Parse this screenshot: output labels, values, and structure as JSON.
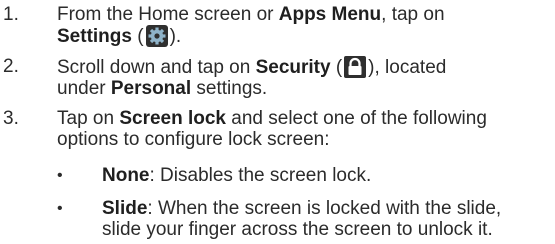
{
  "steps": [
    {
      "number": "1.",
      "line1_pre": "From the Home screen or ",
      "line1_bold": "Apps Menu",
      "line1_post": ", tap on",
      "line2_bold": "Settings",
      "line2_pre_icon": " (",
      "line2_icon": "settings-gear-icon",
      "line2_post": ")."
    },
    {
      "number": "2.",
      "line1_pre": "Scroll down and tap on ",
      "line1_bold": "Security",
      "line1_pre_icon": " (",
      "line1_icon": "lock-icon",
      "line1_post": "), located",
      "line2_pre": "under ",
      "line2_bold": "Personal",
      "line2_post": " settings."
    },
    {
      "number": "3.",
      "line1_pre": "Tap on ",
      "line1_bold": "Screen lock",
      "line1_post": " and select one of the following",
      "line2": "options to configure lock screen:"
    }
  ],
  "bullets": [
    {
      "marker": "•",
      "bold": "None",
      "text": ": Disables the screen lock."
    },
    {
      "marker": "•",
      "bold": "Slide",
      "text": ": When the screen is locked with the slide,",
      "line2": "slide your finger across the screen to unlock it."
    }
  ],
  "colors": {
    "text": "#2b2b2b",
    "icon_background": "#2f2f2f"
  }
}
